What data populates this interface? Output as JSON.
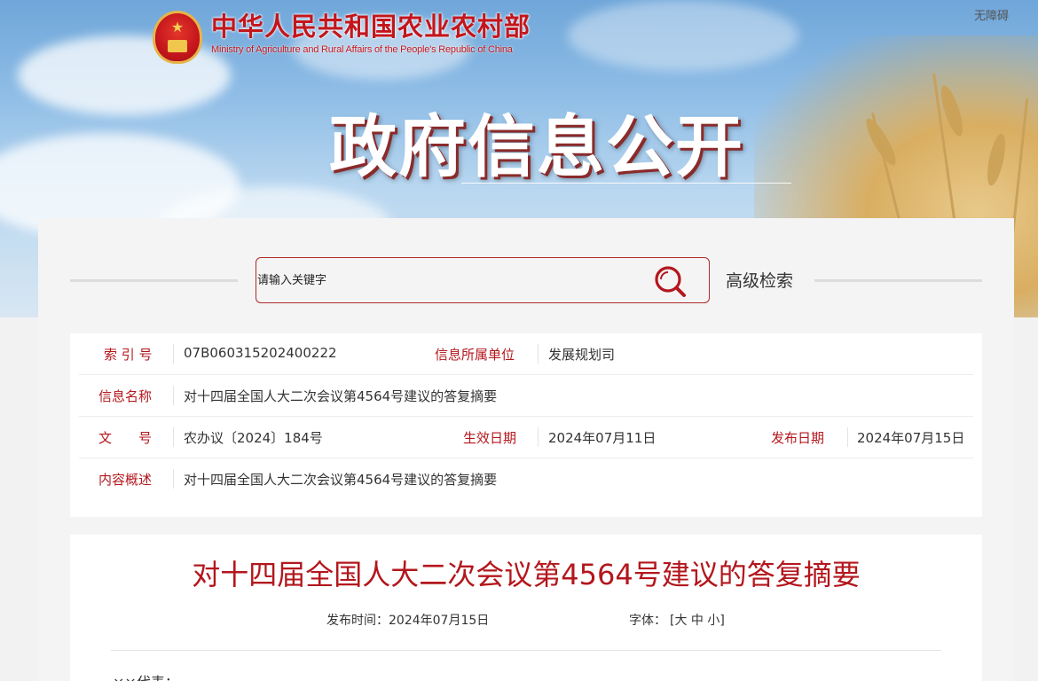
{
  "header": {
    "accessibility_label": "无障碍",
    "ministry_name_cn": "中华人民共和国农业农村部",
    "ministry_name_en": "Ministry of Agriculture and Rural Affairs of the People's Republic of China",
    "section_title": "政府信息公开"
  },
  "search": {
    "placeholder": "请输入关键字",
    "advanced_label": "高级检索"
  },
  "meta": {
    "index_label": "索 引 号",
    "index_value": "07B060315202400222",
    "unit_label": "信息所属单位",
    "unit_value": "发展规划司",
    "name_label": "信息名称",
    "name_value": "对十四届全国人大二次会议第4564号建议的答复摘要",
    "doc_label": "文　　号",
    "doc_value": "农办议〔2024〕184号",
    "effective_label": "生效日期",
    "effective_value": "2024年07月11日",
    "publish_label": "发布日期",
    "publish_value": "2024年07月15日",
    "summary_label": "内容概述",
    "summary_value": "对十四届全国人大二次会议第4564号建议的答复摘要"
  },
  "article": {
    "title": "对十四届全国人大二次会议第4564号建议的答复摘要",
    "publish_time": "发布时间：2024年07月15日",
    "font_size_label": "字体：",
    "font_size_options": "[大 中 小]",
    "first_line_fragment": "××代表："
  },
  "colors": {
    "accent_red": "#b3171d",
    "emblem_gold": "#e6b54a"
  }
}
